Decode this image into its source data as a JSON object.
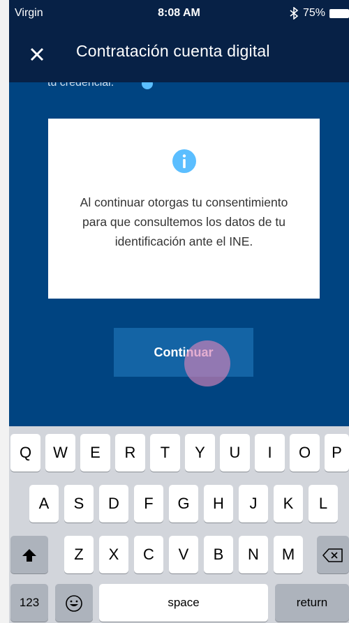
{
  "status_bar": {
    "carrier": "Virgin",
    "time": "8:08 AM",
    "battery": "75%"
  },
  "nav": {
    "title": "Contratación cuenta digital"
  },
  "background_text": "tu credencial.",
  "dialog": {
    "message": "Al continuar otorgas tu consentimiento para que consultemos los datos de tu identificación ante el INE."
  },
  "continue_label": "Continuar",
  "keyboard": {
    "row1": [
      "Q",
      "W",
      "E",
      "R",
      "T",
      "Y",
      "U",
      "I",
      "O",
      "P"
    ],
    "row2": [
      "A",
      "S",
      "D",
      "F",
      "G",
      "H",
      "J",
      "K",
      "L"
    ],
    "row3": [
      "Z",
      "X",
      "C",
      "V",
      "B",
      "N",
      "M"
    ],
    "numbers_label": "123",
    "space_label": "space",
    "return_label": "return"
  },
  "colors": {
    "header": "#072146",
    "background": "#004481",
    "button": "#1464a5",
    "info_icon": "#5bbeff"
  }
}
